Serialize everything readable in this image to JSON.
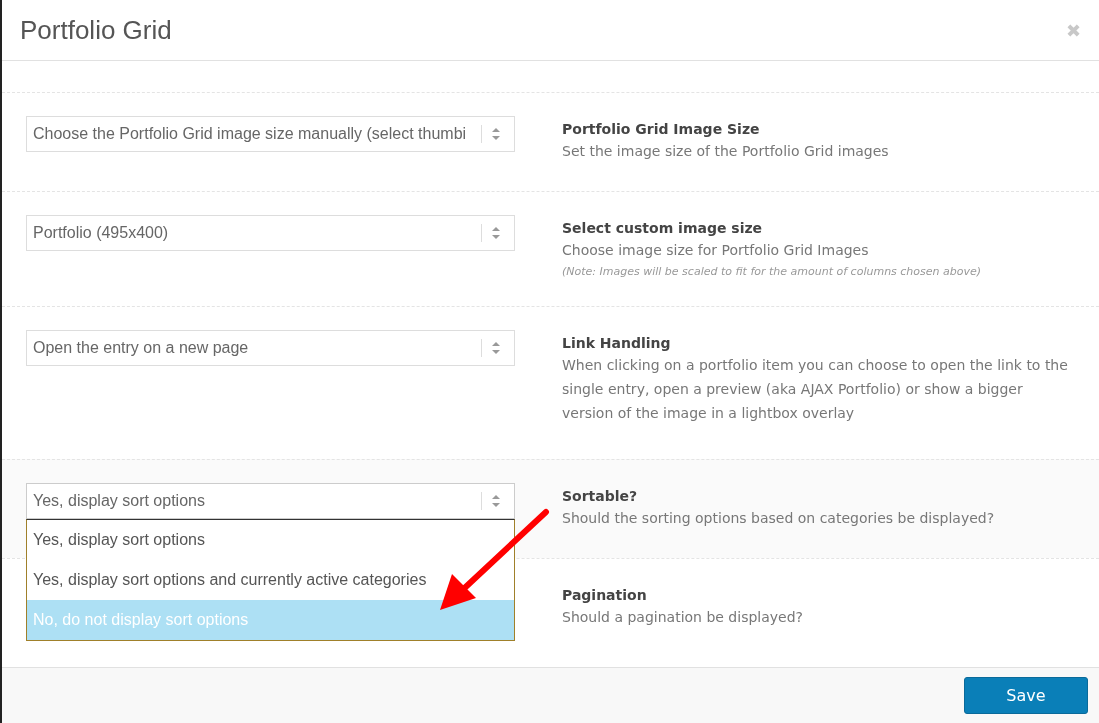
{
  "dialog": {
    "title": "Portfolio Grid",
    "close": "✖"
  },
  "settings": [
    {
      "kind": "select",
      "value": "Choose the Portfolio Grid image size manually (select thumbi",
      "label": "Portfolio Grid Image Size",
      "description": "Set the image size of the Portfolio Grid images"
    },
    {
      "kind": "select",
      "value": "Portfolio (495x400)",
      "label": "Select custom image size",
      "description": "Choose image size for Portfolio Grid Images",
      "note": "(Note: Images will be scaled to fit for the amount of columns chosen above)"
    },
    {
      "kind": "select",
      "value": "Open the entry on a new page",
      "label": "Link Handling",
      "description": "When clicking on a portfolio item you can choose to open the link to the single entry, open a preview (aka AJAX Portfolio) or show a bigger version of the image in a lightbox overlay"
    },
    {
      "kind": "select",
      "value": "Yes, display sort options",
      "label": "Sortable?",
      "description": "Should the sorting options based on categories be displayed?",
      "open": true,
      "options": [
        {
          "label": "Yes, display sort options",
          "highlighted": false
        },
        {
          "label": "Yes, display sort options and currently active categories",
          "highlighted": false
        },
        {
          "label": "No, do not display sort options",
          "highlighted": true
        }
      ]
    },
    {
      "kind": "covered",
      "label": "Pagination",
      "description": "Should a pagination be displayed?"
    }
  ],
  "footer": {
    "save": "Save"
  }
}
